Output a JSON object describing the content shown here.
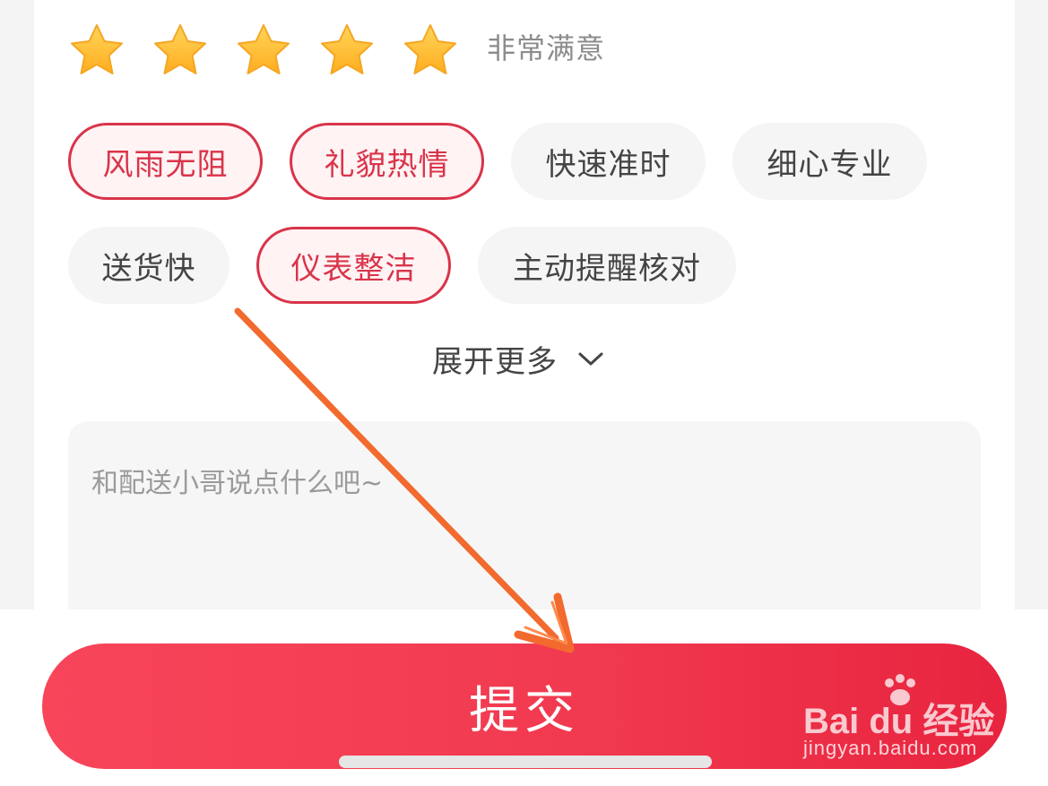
{
  "rating": {
    "stars_total": 5,
    "stars_filled": 5,
    "label": "非常满意",
    "star_color": "#ffc23d"
  },
  "tags": {
    "row1": [
      {
        "label": "风雨无阻",
        "selected": true
      },
      {
        "label": "礼貌热情",
        "selected": true
      },
      {
        "label": "快速准时",
        "selected": false
      },
      {
        "label": "细心专业",
        "selected": false
      }
    ],
    "row2": [
      {
        "label": "送货快",
        "selected": false
      },
      {
        "label": "仪表整洁",
        "selected": true
      },
      {
        "label": "主动提醒核对",
        "selected": false
      }
    ]
  },
  "expand": {
    "label": "展开更多",
    "icon": "chevron-down-icon"
  },
  "comment": {
    "placeholder": "和配送小哥说点什么吧~",
    "value": ""
  },
  "submit": {
    "label": "提交"
  },
  "watermark": {
    "brand_mark": "Bai du 经验",
    "url": "jingyan.baidu.com"
  },
  "colors": {
    "accent": "#f13a50",
    "selected_border": "#d9344a",
    "selected_bg": "#fff3f4",
    "annotation_arrow": "#f26a2e"
  }
}
